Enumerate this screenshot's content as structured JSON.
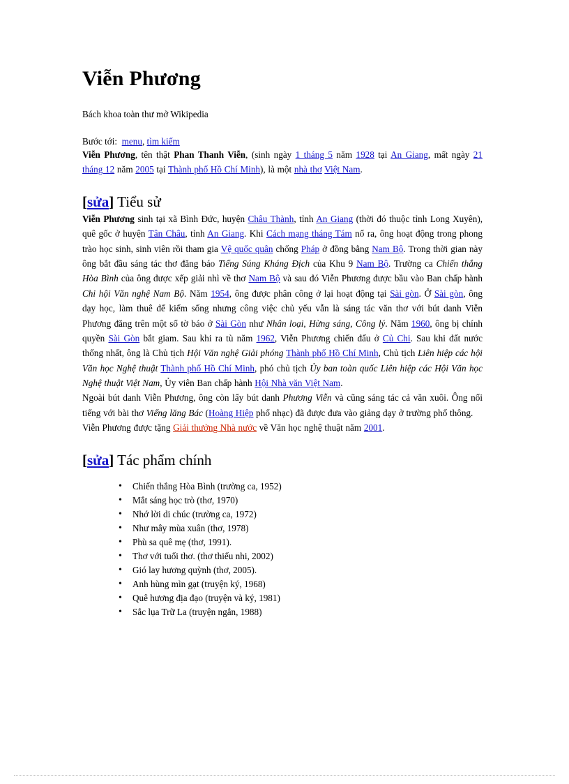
{
  "document": {
    "title": "Viễn Phương",
    "tagline": "Bách khoa toàn thư mở Wikipedia",
    "jump": {
      "label": "Bước tới:",
      "link_menu": "menu",
      "separator": ", ",
      "link_search": "tìm kiếm"
    }
  },
  "intro": {
    "name_bold": "Viễn Phương",
    "t1": ", tên thật ",
    "real_name_bold": "Phan Thanh Viễn",
    "t2": ", (sinh ngày ",
    "link_birth_date": "1 tháng 5",
    "t3": " năm ",
    "link_birth_year": "1928",
    "t4": " tại ",
    "link_birth_place": "An Giang",
    "t5": ", mất ngày ",
    "link_death_date": "21 tháng 12",
    "t6": " năm ",
    "link_death_year": "2005",
    "t7": " tại ",
    "link_death_place": "Thành phố Hồ Chí Minh",
    "t8": "), là một ",
    "link_poet": "nhà thơ",
    "t9": " ",
    "link_country": "Việt Nam",
    "t10": "."
  },
  "section_bio": {
    "edit_open": "[",
    "edit_label": "sửa",
    "edit_close": "]",
    "heading": " Tiểu sử",
    "p1": {
      "name_bold": "Viễn Phương",
      "t1": " sinh tại xã Bình Đức, huyện ",
      "l1": "Châu Thành",
      "t2": ", tỉnh ",
      "l2": "An Giang",
      "t3": " (thời đó thuộc tỉnh Long Xuyên), quê gốc ở huyện ",
      "l3": "Tân Châu",
      "t4": ", tỉnh ",
      "l4": "An Giang",
      "t5": ". Khi ",
      "l5": "Cách mạng tháng Tám",
      "t6": " nổ ra, ông hoạt động trong phong trào học sinh, sinh viên rồi tham gia ",
      "l6": "Vệ quốc quân",
      "t7": " chống ",
      "l7": "Pháp",
      "t8": " ở đồng bằng ",
      "l8": "Nam Bộ",
      "t9": ". Trong thời gian này ông bắt đầu sáng tác thơ đăng báo ",
      "i1": "Tiếng Súng Kháng Địch",
      "t10": " của Khu 9 ",
      "l9": "Nam Bộ",
      "t11": ". Trường ca ",
      "i2": "Chiến thắng Hòa Bình",
      "t12": " của ông được xếp giải nhì về thơ ",
      "l10": "Nam Bộ",
      "t13": " và sau đó Viễn Phương được bầu vào Ban chấp hành ",
      "i3": "Chi hội Văn nghệ Nam Bộ",
      "t14": ". Năm ",
      "l11": "1954",
      "t15": ", ông được phân công ở lại hoạt động tại ",
      "l12": "Sài gòn",
      "t16": ". Ở ",
      "l13": "Sài gòn",
      "t17": ", ông dạy học, làm thuê để kiếm sống nhưng công việc chủ yếu vẫn là sáng tác văn thơ với bút danh Viễn Phương đăng trên một số tờ báo ở ",
      "l14": "Sài Gòn",
      "t18": " như ",
      "i4": "Nhân loại",
      "t19": ", ",
      "i5": "Hừng sáng",
      "t20": ", ",
      "i6": "Công lý",
      "t21": ". Năm ",
      "l15": "1960",
      "t22": ", ông bị chính quyền ",
      "l16": "Sài Gòn",
      "t23": " bắt giam. Sau khi ra tù năm ",
      "l17": "1962",
      "t24": ", Viễn Phương chiến đấu ở ",
      "l18": "Củ Chi",
      "t25": ". Sau khi đất nước thống nhất, ông là Chủ tịch ",
      "i7": "Hội Văn nghệ Giải phóng",
      "t26": " ",
      "l19": "Thành phố Hồ Chí Minh",
      "t27": ", Chủ tịch ",
      "i8": "Liên hiệp các hội Văn học Nghệ thuật",
      "t28": " ",
      "l20": "Thành phố Hồ Chí Minh",
      "t29": ", phó chủ tịch ",
      "i9": "Ủy ban toàn quốc Liên hiệp các Hội Văn học Nghệ thuật Việt Nam",
      "t30": ", Ủy viên Ban chấp hành ",
      "l21": "Hội Nhà văn Việt Nam",
      "t31": "."
    },
    "p2": {
      "t1": "Ngoài bút danh Viễn Phương, ông còn lấy bút danh ",
      "i1": "Phương Viễn",
      "t2": " và cũng sáng tác cả văn xuôi. Ông nổi tiếng với bài thơ ",
      "i2": "Viếng lăng Bác",
      "t3": " (",
      "l1": "Hoàng Hiệp",
      "t4": " phổ nhạc) đã được đưa vào giảng dạy ở trường phổ thông."
    },
    "p3": {
      "t1": "Viễn Phương được tặng ",
      "l1": "Giải thưởng Nhà nước",
      "t2": " về Văn học nghệ thuật năm ",
      "l2": "2001",
      "t3": "."
    }
  },
  "section_works": {
    "edit_open": "[",
    "edit_label": "sửa",
    "edit_close": "]",
    "heading": " Tác phẩm chính",
    "items": [
      "Chiến thắng Hòa Bình (trường ca, 1952)",
      "Mắt sáng học trò (thơ, 1970)",
      "Nhớ lời di chúc (trường ca, 1972)",
      "Như mây mùa xuân (thơ, 1978)",
      "Phù sa quê mẹ (thơ, 1991).",
      "Thơ với tuổi thơ. (thơ thiếu nhi, 2002)",
      "Gió lay hương quỳnh (thơ, 2005).",
      "Anh hùng mìn gạt (truyện ký, 1968)",
      "Quê hương địa đạo (truyện và ký, 1981)",
      "Sắc lụa Trữ La (truyện ngắn, 1988)"
    ]
  },
  "colors": {
    "link_blue": "#1414c8",
    "link_red": "#cc2200",
    "text": "#000000",
    "background": "#ffffff",
    "footer_rule": "#b9b9b9"
  }
}
